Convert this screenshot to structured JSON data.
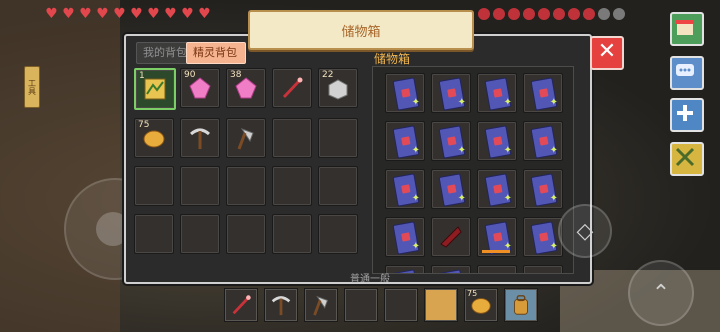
{
  "title": "储物箱",
  "tabs": [
    {
      "label": "我的背包",
      "active": false
    },
    {
      "label": "精灵背包",
      "active": true
    }
  ],
  "storage_label": "储物箱",
  "close_label": "✕",
  "hotbar_label": "普通一般",
  "side_tab_label": "工具",
  "left_grid": [
    {
      "count": "1",
      "item": "map-icon",
      "selected": true
    },
    {
      "count": "90",
      "item": "pink-crystal-icon"
    },
    {
      "count": "38",
      "item": "pink-crystal-icon"
    },
    {
      "count": "",
      "item": "red-wand-icon"
    },
    {
      "count": "22",
      "item": "stone-block-icon"
    },
    {
      "count": "75",
      "item": "bread-icon"
    },
    {
      "count": "",
      "item": "pickaxe-icon"
    },
    {
      "count": "",
      "item": "axe-icon"
    }
  ],
  "right_grid_top_counts": [],
  "hotbar": [
    {
      "count": "",
      "item": "red-wand-icon"
    },
    {
      "count": "",
      "item": "pickaxe-icon"
    },
    {
      "count": "",
      "item": "axe-icon"
    },
    {
      "count": "",
      "item": "empty"
    },
    {
      "count": "",
      "item": "empty"
    },
    {
      "count": "",
      "item": "empty",
      "active": true
    },
    {
      "count": "75",
      "item": "bread-icon"
    },
    {
      "count": "",
      "item": "backpack-icon"
    }
  ],
  "colors": {
    "heart": "#e1474c",
    "accent_orange": "#f2b64f",
    "close": "#e4413f",
    "selected_slot": "#7ccf67"
  }
}
